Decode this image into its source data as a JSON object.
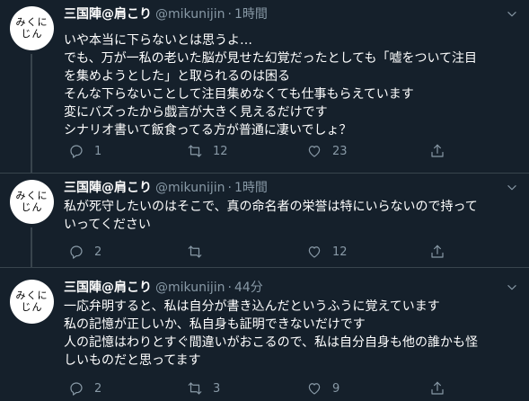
{
  "tweets": [
    {
      "avatar_text": "みくに\nじん",
      "name": "三国陣@肩こり",
      "handle": "@mikunijin",
      "time": "1時間",
      "text": "いや本当に下らないとは思うよ…\nでも、万が一私の老いた脳が見せた幻覚だったとしても「嘘をついて注目\nを集めようとした」と取られるのは困る\nそんな下らないことして注目集めなくても仕事もらえています\n変にバズったから戯言が大きく見えるだけです\nシナリオ書いて飯食ってる方が普通に凄いでしょ？",
      "reply_count": "1",
      "retweet_count": "12",
      "like_count": "23"
    },
    {
      "avatar_text": "みくに\nじん",
      "name": "三国陣@肩こり",
      "handle": "@mikunijin",
      "time": "1時間",
      "text": "私が死守したいのはそこで、真の命名者の栄誉は特にいらないので持って\nいってください",
      "reply_count": "2",
      "retweet_count": "",
      "like_count": "12"
    },
    {
      "avatar_text": "みくに\nじん",
      "name": "三国陣@肩こり",
      "handle": "@mikunijin",
      "time": "44分",
      "text": "一応弁明すると、私は自分が書き込んだというふうに覚えています\n私の記憶が正しいか、私自身も証明できないだけです\n人の記憶はわりとすぐ間違いがおこるので、私は自分自身も他の誰かも怪\nしいものだと思ってます",
      "reply_count": "2",
      "retweet_count": "3",
      "like_count": "9"
    }
  ],
  "icons": {
    "reply": "reply-icon",
    "retweet": "retweet-icon",
    "like": "like-icon",
    "share": "share-icon",
    "caret": "chevron-down-icon"
  },
  "colors": {
    "background": "#15202b",
    "text": "#ffffff",
    "muted": "#8899a6",
    "divider": "#38444d"
  }
}
